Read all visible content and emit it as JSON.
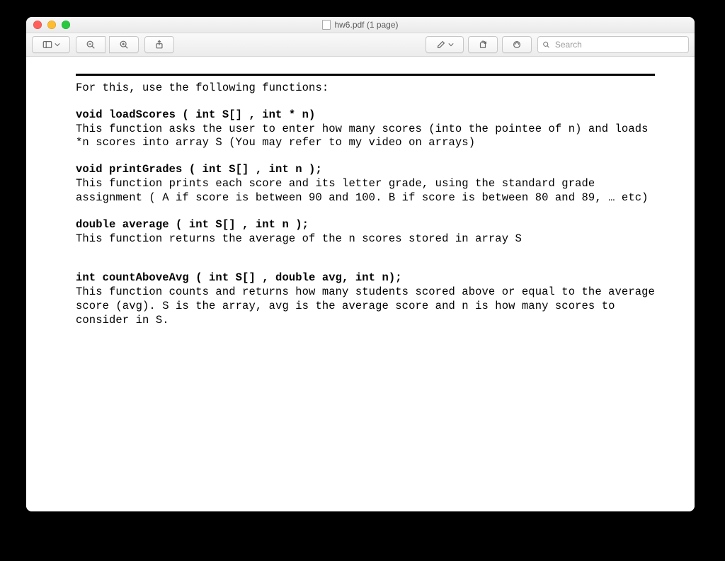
{
  "window": {
    "title": "hw6.pdf (1 page)"
  },
  "toolbar": {
    "search_placeholder": "Search"
  },
  "doc": {
    "intro": "For this, use the following functions:",
    "f1": {
      "sig": "void loadScores ( int S[] , int * n)",
      "desc": "This function asks the user to enter how many scores (into the pointee of n) and loads *n scores into array S (You may refer to my video on arrays)"
    },
    "f2": {
      "sig": "void printGrades ( int S[] , int n );",
      "desc": "This function prints each score and its letter grade, using the standard grade assignment ( A if score is between 90 and 100. B if score is between 80 and 89, … etc)"
    },
    "f3": {
      "sig": "double average ( int S[] , int n );",
      "desc": "This function returns the average of the n scores stored in array S"
    },
    "f4": {
      "sig": "int countAboveAvg ( int S[] , double avg, int n);",
      "desc": "This function counts and returns how many students scored above or equal to the average score (avg). S is the array, avg is the average score and n is how many scores to consider in S."
    }
  }
}
